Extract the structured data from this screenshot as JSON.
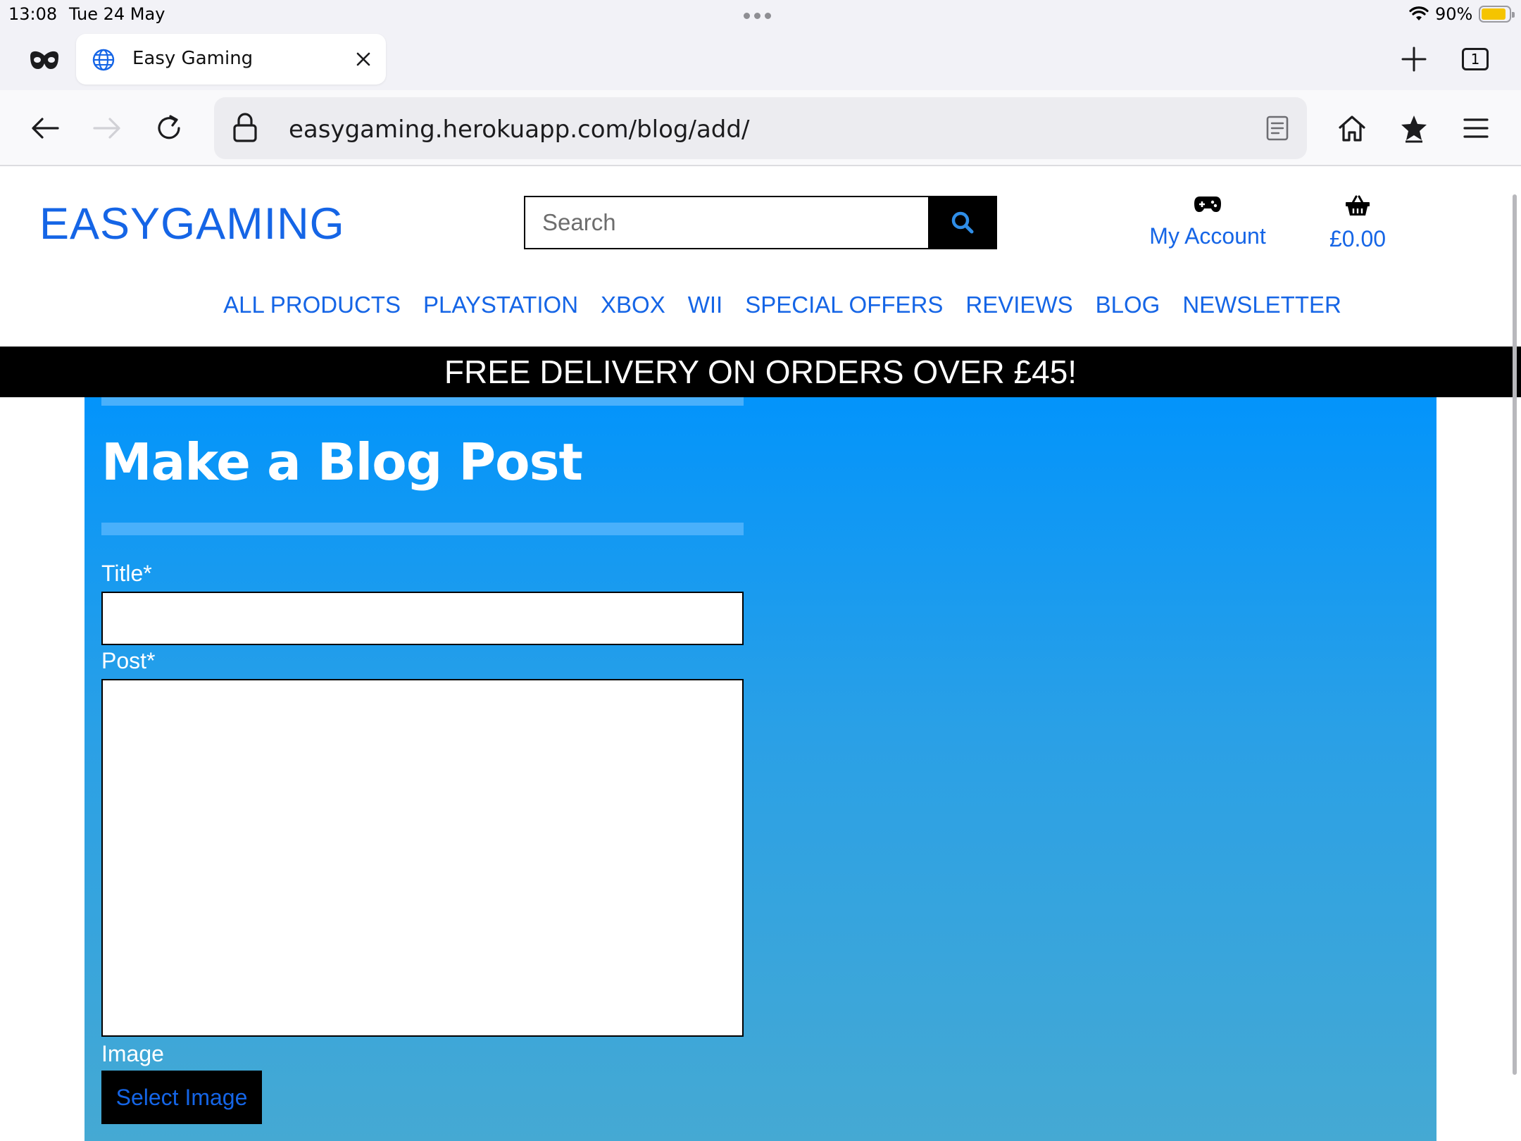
{
  "status_bar": {
    "time": "13:08",
    "date": "Tue 24 May",
    "battery_percent": "90%",
    "battery_level": 0.9
  },
  "tabs": [
    {
      "title": "Easy Gaming"
    }
  ],
  "tab_count": "1",
  "toolbar": {
    "url": "easygaming.herokuapp.com/blog/add/"
  },
  "site": {
    "logo_part1": "EASY",
    "logo_part2": "GAMING",
    "search_placeholder": "Search",
    "account_label": "My Account",
    "basket_total": "£0.00",
    "nav": [
      "ALL PRODUCTS",
      "PLAYSTATION",
      "XBOX",
      "WII",
      "SPECIAL OFFERS",
      "REVIEWS",
      "BLOG",
      "NEWSLETTER"
    ],
    "banner": "FREE DELIVERY ON ORDERS OVER £45!"
  },
  "form": {
    "heading": "Make a Blog Post",
    "title_label": "Title*",
    "title_value": "",
    "post_label": "Post*",
    "post_value": "",
    "image_label": "Image",
    "select_image_label": "Select Image"
  },
  "colors": {
    "brand_blue": "#1565e6",
    "banner_bg": "#000000",
    "content_bg_top": "#0394fb",
    "content_bg_bottom": "#45a9d3",
    "battery_fill": "#f5c400"
  }
}
